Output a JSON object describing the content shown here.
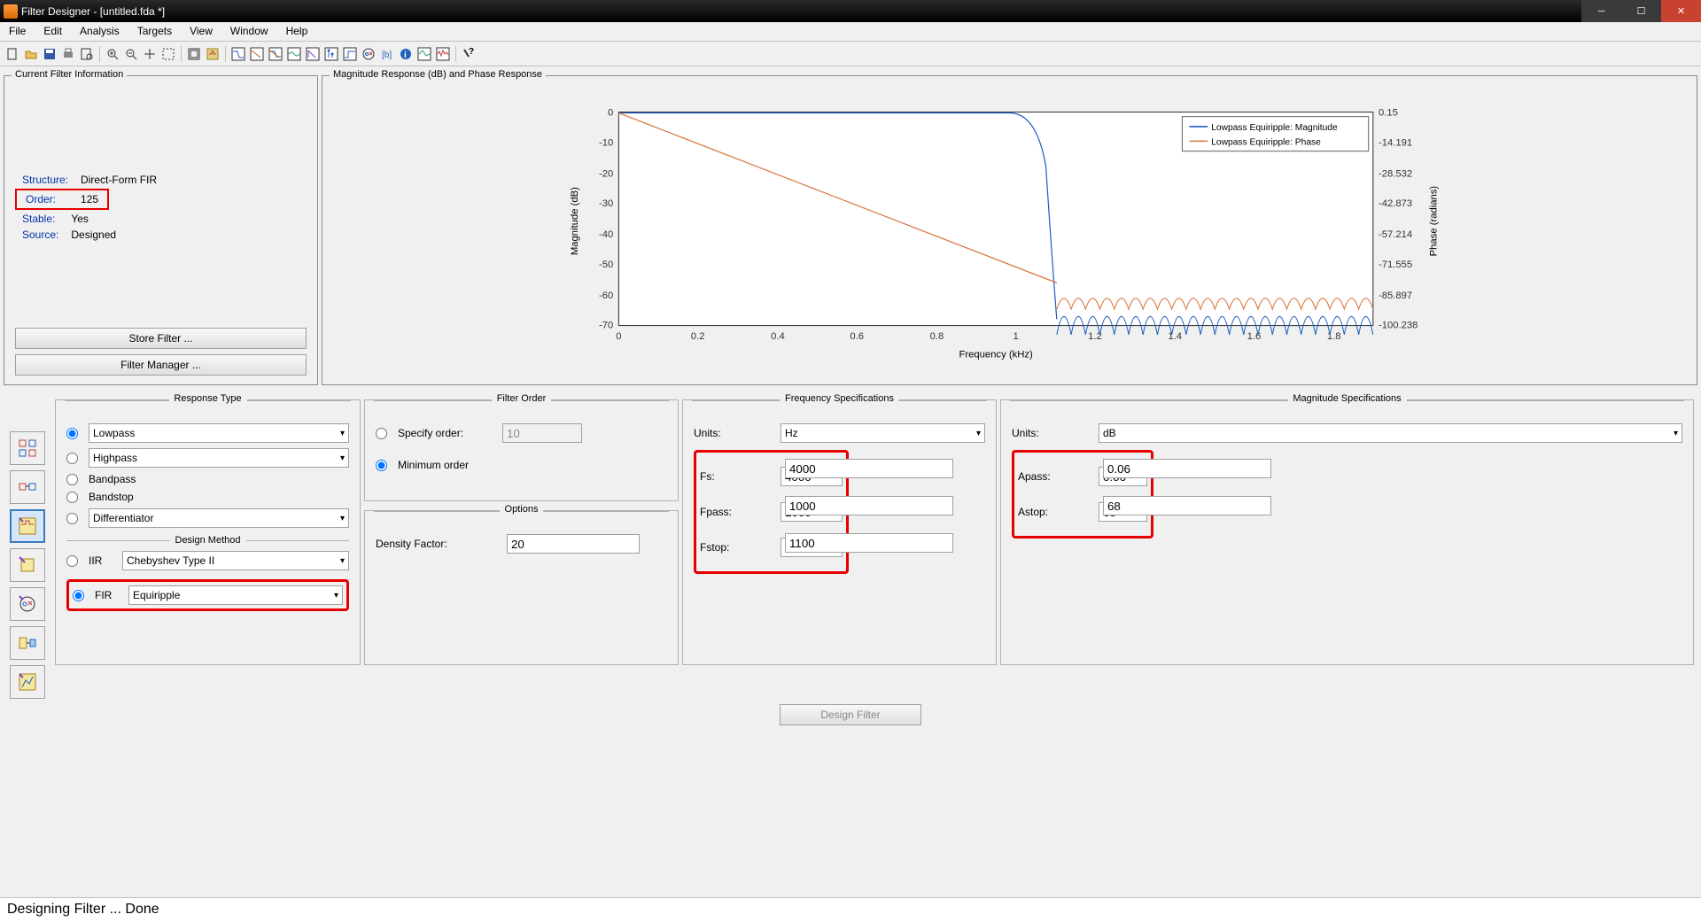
{
  "title": "Filter Designer -   [untitled.fda *]",
  "menu": [
    "File",
    "Edit",
    "Analysis",
    "Targets",
    "View",
    "Window",
    "Help"
  ],
  "filter_info": {
    "title": "Current Filter Information",
    "structure_label": "Structure:",
    "structure": "Direct-Form FIR",
    "order_label": "Order:",
    "order": "125",
    "stable_label": "Stable:",
    "stable": "Yes",
    "source_label": "Source:",
    "source": "Designed",
    "store_btn": "Store Filter ...",
    "manager_btn": "Filter Manager ..."
  },
  "plot": {
    "title": "Magnitude Response (dB) and Phase Response",
    "xlabel": "Frequency (kHz)",
    "ylabel_left": "Magnitude (dB)",
    "ylabel_right": "Phase (radians)",
    "legend1": "Lowpass Equiripple: Magnitude",
    "legend2": "Lowpass Equiripple: Phase",
    "xticks": [
      "0",
      "0.2",
      "0.4",
      "0.6",
      "0.8",
      "1",
      "1.2",
      "1.4",
      "1.6",
      "1.8"
    ],
    "yticks_left": [
      "0",
      "-10",
      "-20",
      "-30",
      "-40",
      "-50",
      "-60",
      "-70"
    ],
    "yticks_right": [
      "0.15",
      "-14.191",
      "-28.532",
      "-42.873",
      "-57.214",
      "-71.555",
      "-85.897",
      "-100.238"
    ]
  },
  "chart_data": {
    "type": "line",
    "x_range_khz": [
      0,
      1.9
    ],
    "series": [
      {
        "name": "Lowpass Equiripple: Magnitude",
        "axis": "left",
        "approx": [
          [
            0,
            0
          ],
          [
            0.9,
            0
          ],
          [
            1.0,
            0
          ],
          [
            1.05,
            -30
          ],
          [
            1.09,
            -68
          ],
          [
            1.1,
            -68
          ]
        ],
        "ripple_khz": [
          1.1,
          1.9
        ],
        "ripple_center_db": -72,
        "ripple_amp_db": 6
      },
      {
        "name": "Lowpass Equiripple: Phase",
        "axis": "right",
        "approx": [
          [
            0,
            0
          ],
          [
            1.1,
            -80
          ]
        ],
        "ripple_khz": [
          1.1,
          1.9
        ],
        "ripple_center_rad": -88,
        "ripple_amp_rad": 6
      }
    ]
  },
  "response_type": {
    "title": "Response Type",
    "lowpass": "Lowpass",
    "highpass": "Highpass",
    "bandpass": "Bandpass",
    "bandstop": "Bandstop",
    "differentiator": "Differentiator",
    "design_method": "Design Method",
    "iir": "IIR",
    "iir_val": "Chebyshev Type II",
    "fir": "FIR",
    "fir_val": "Equiripple"
  },
  "filter_order": {
    "title": "Filter Order",
    "specify": "Specify order:",
    "specify_val": "10",
    "min": "Minimum order"
  },
  "options": {
    "title": "Options",
    "density": "Density Factor:",
    "density_val": "20"
  },
  "freq": {
    "title": "Frequency Specifications",
    "units_lbl": "Units:",
    "units": "Hz",
    "fs_lbl": "Fs:",
    "fs": "4000",
    "fpass_lbl": "Fpass:",
    "fpass": "1000",
    "fstop_lbl": "Fstop:",
    "fstop": "1100"
  },
  "mag": {
    "title": "Magnitude Specifications",
    "units_lbl": "Units:",
    "units": "dB",
    "apass_lbl": "Apass:",
    "apass": "0.06",
    "astop_lbl": "Astop:",
    "astop": "68"
  },
  "design_btn": "Design Filter",
  "status": "Designing Filter ... Done"
}
